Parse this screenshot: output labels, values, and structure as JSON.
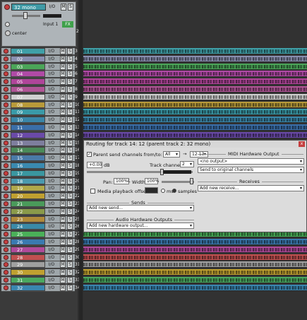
{
  "master": {
    "name": "32 mono",
    "io_label": "I/O",
    "m": "M",
    "s": "S",
    "input_label": "Input 1",
    "fx_label": "FX",
    "center_label": "center",
    "track_number": "2"
  },
  "tracks": [
    {
      "num": "01",
      "idx": "3",
      "color": "#3fa0a8"
    },
    {
      "num": "02",
      "idx": "4",
      "color": "#8a8fb0"
    },
    {
      "num": "03",
      "idx": "5",
      "color": "#4ba558"
    },
    {
      "num": "04",
      "idx": "6",
      "color": "#b04aa6"
    },
    {
      "num": "05",
      "idx": "7",
      "color": "#b0459a"
    },
    {
      "num": "06",
      "idx": "8",
      "color": "#b05596"
    },
    {
      "num": "07",
      "idx": "9",
      "color": "#d0d0d0"
    },
    {
      "num": "08",
      "idx": "10",
      "color": "#b89a3a"
    },
    {
      "num": "09",
      "idx": "11",
      "color": "#3a9aa8"
    },
    {
      "num": "10",
      "idx": "12",
      "color": "#3a86a8"
    },
    {
      "num": "11",
      "idx": "13",
      "color": "#3a6ea8"
    },
    {
      "num": "12",
      "idx": "14",
      "color": "#6a4aa8"
    },
    {
      "num": "13",
      "idx": "15",
      "color": "#7e7e9e"
    },
    {
      "num": "14",
      "idx": "16",
      "color": "#4a8a58"
    },
    {
      "num": "15",
      "idx": "17",
      "color": "#4a7aa8"
    },
    {
      "num": "16",
      "idx": "18",
      "color": "#3a8ab0"
    },
    {
      "num": "17",
      "idx": "19",
      "color": "#3a96a0"
    },
    {
      "num": "18",
      "idx": "20",
      "color": "#4a9ab0"
    },
    {
      "num": "19",
      "idx": "21",
      "color": "#b0a84a"
    },
    {
      "num": "20",
      "idx": "22",
      "color": "#c0a030"
    },
    {
      "num": "21",
      "idx": "23",
      "color": "#4a9a5a"
    },
    {
      "num": "22",
      "idx": "24",
      "color": "#8a9a4a"
    },
    {
      "num": "23",
      "idx": "25",
      "color": "#b08a3a"
    },
    {
      "num": "24",
      "idx": "26",
      "color": "#3a8aa8"
    },
    {
      "num": "25",
      "idx": "27",
      "color": "#4ab058"
    },
    {
      "num": "26",
      "idx": "28",
      "color": "#3a7ab0"
    },
    {
      "num": "27",
      "idx": "29",
      "color": "#b04a9a"
    },
    {
      "num": "28",
      "idx": "30",
      "color": "#c05050"
    },
    {
      "num": "29",
      "idx": "31",
      "color": "#a0a0a0"
    },
    {
      "num": "30",
      "idx": "32",
      "color": "#c0a030"
    },
    {
      "num": "31",
      "idx": "33",
      "color": "#4aa860"
    },
    {
      "num": "32",
      "idx": "34",
      "color": "#3a86b0"
    }
  ],
  "track_button_labels": {
    "io": "I/O",
    "m": "M",
    "s": "S"
  },
  "routing": {
    "title": "Routing for track 14: 12  (parent track 2: 32 mono)",
    "close": "x",
    "parent_send_label": "Parent send channels from/to:",
    "parent_from": "All",
    "arrow": "→",
    "parent_to": "12-13",
    "volume": "+0.00",
    "db": "dB",
    "track_channels_label": "Track channels:",
    "track_channels_value": "2",
    "pan_label": "Pan:",
    "pan_value": "100%L",
    "width_label": "Width:",
    "width_value": "100%",
    "media_offset_label": "Media playback offset:",
    "ms_label": "ms",
    "samples_label": "samples",
    "sends_header": "Sends",
    "add_send": "Add new send...",
    "audio_hw_header": "Audio Hardware Outputs",
    "add_hw_output": "Add new hardware output...",
    "midi_hw_header": "MIDI Hardware Output",
    "midi_output": "<no output>",
    "midi_channels": "Send to original channels",
    "receives_header": "Receives",
    "add_receive": "Add new receive..."
  }
}
